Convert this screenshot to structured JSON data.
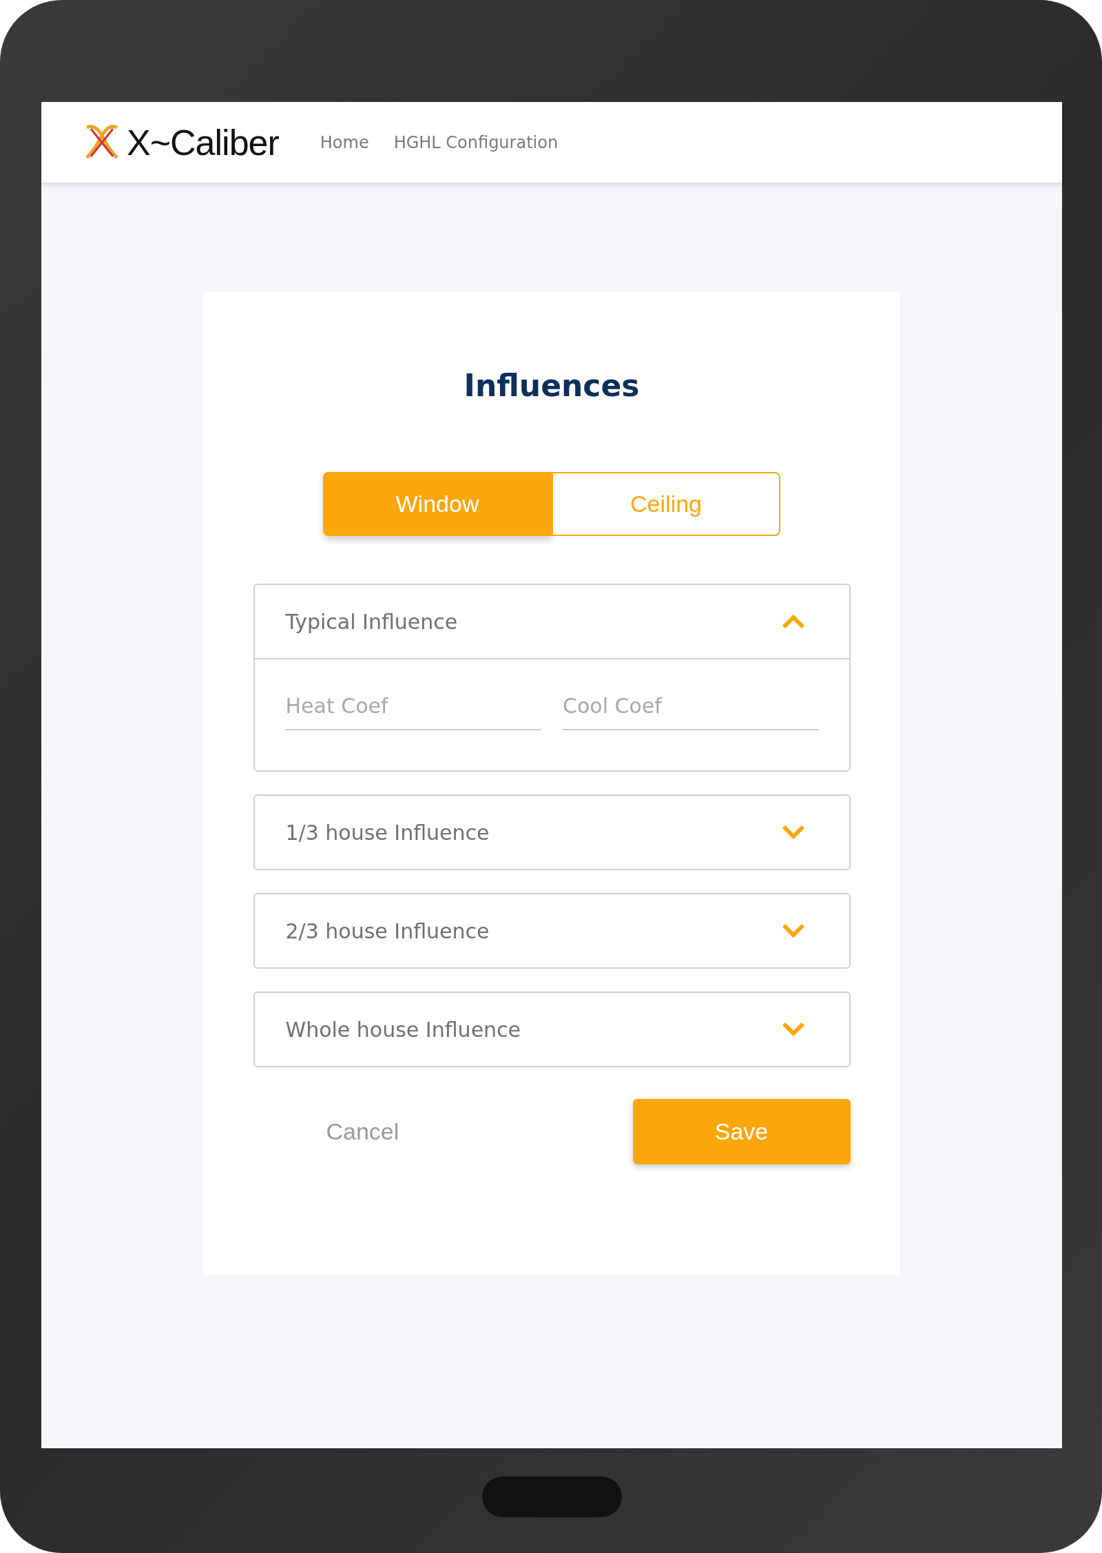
{
  "header": {
    "brand": "X~Caliber",
    "nav": [
      {
        "label": "Home"
      },
      {
        "label": "HGHL Configuration"
      }
    ]
  },
  "card": {
    "title": "Influences",
    "tabs": [
      {
        "label": "Window",
        "selected": true
      },
      {
        "label": "Ceiling",
        "selected": false
      }
    ],
    "sections": [
      {
        "title": "Typical Influence",
        "expanded": true,
        "fields": [
          {
            "placeholder": "Heat Coef"
          },
          {
            "placeholder": "Cool Coef"
          }
        ]
      },
      {
        "title": "1/3 house Influence",
        "expanded": false
      },
      {
        "title": "2/3 house Influence",
        "expanded": false
      },
      {
        "title": "Whole house Influence",
        "expanded": false
      }
    ],
    "buttons": {
      "cancel": "Cancel",
      "save": "Save"
    }
  }
}
